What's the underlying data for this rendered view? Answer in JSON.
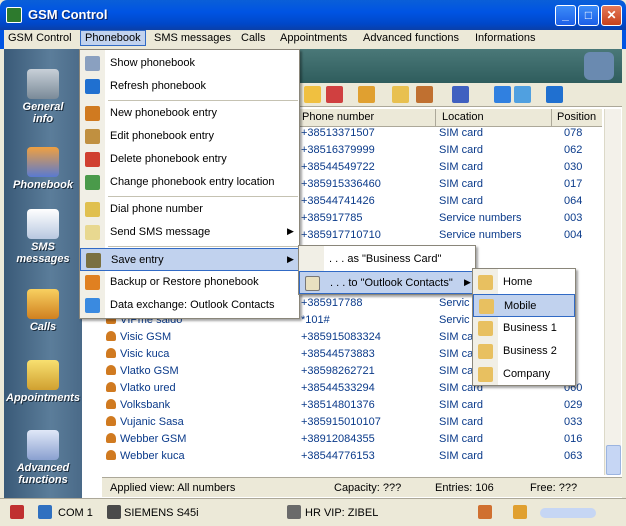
{
  "window": {
    "title": "GSM Control"
  },
  "menubar": [
    "GSM Control",
    "Phonebook",
    "SMS messages",
    "Calls",
    "Appointments",
    "Advanced functions",
    "Informations"
  ],
  "sidebar": {
    "items": [
      {
        "label_line1": "General",
        "label_line2": "info",
        "icon": "phone-icon"
      },
      {
        "label_line1": "Phonebook",
        "label_line2": "",
        "icon": "people-icon"
      },
      {
        "label_line1": "SMS",
        "label_line2": "messages",
        "icon": "envelope-icon"
      },
      {
        "label_line1": "Calls",
        "label_line2": "",
        "icon": "calls-icon"
      },
      {
        "label_line1": "Appointments",
        "label_line2": "",
        "icon": "calendar-icon"
      },
      {
        "label_line1": "Advanced",
        "label_line2": "functions",
        "icon": "tools-icon"
      }
    ]
  },
  "grid": {
    "columns": [
      "Phone number",
      "Location",
      "Position"
    ],
    "rows": [
      {
        "name": "",
        "phone": "+38513371507",
        "location": "SIM card",
        "position": "078"
      },
      {
        "name": "",
        "phone": "+38516379999",
        "location": "SIM card",
        "position": "062"
      },
      {
        "name": "",
        "phone": "+38544549722",
        "location": "SIM card",
        "position": "030"
      },
      {
        "name": "",
        "phone": "+385915336460",
        "location": "SIM card",
        "position": "017"
      },
      {
        "name": "",
        "phone": "+38544741426",
        "location": "SIM card",
        "position": "064"
      },
      {
        "name": "",
        "phone": "+385917785",
        "location": "Service numbers",
        "position": "003"
      },
      {
        "name": "",
        "phone": "+385917710710",
        "location": "Service numbers",
        "position": "004"
      },
      {
        "name": "",
        "phone": "",
        "location": "",
        "position": ""
      },
      {
        "name": "",
        "phone": "",
        "location": "",
        "position": ""
      },
      {
        "name": "",
        "phone": "",
        "location": "",
        "position": ""
      },
      {
        "name": "",
        "phone": "+385917788",
        "location": "Servic",
        "position": ""
      },
      {
        "name": "VIPme saldo",
        "phone": "*101#",
        "location": "Servic",
        "position": ""
      },
      {
        "name": "Visic GSM",
        "phone": "+385915083324",
        "location": "SIM ca",
        "position": ""
      },
      {
        "name": "Visic kuca",
        "phone": "+38544573883",
        "location": "SIM ca",
        "position": ""
      },
      {
        "name": "Vlatko GSM",
        "phone": "+38598262721",
        "location": "SIM ca",
        "position": ""
      },
      {
        "name": "Vlatko ured",
        "phone": "+38544533294",
        "location": "SIM card",
        "position": "060"
      },
      {
        "name": "Volksbank",
        "phone": "+38514801376",
        "location": "SIM card",
        "position": "029"
      },
      {
        "name": "Vujanic Sasa",
        "phone": "+385915010107",
        "location": "SIM card",
        "position": "033"
      },
      {
        "name": "Webber GSM",
        "phone": "+38912084355",
        "location": "SIM card",
        "position": "016"
      },
      {
        "name": "Webber kuca",
        "phone": "+38544776153",
        "location": "SIM card",
        "position": "063"
      }
    ]
  },
  "infobar": {
    "applied_view": "Applied view:  All numbers",
    "capacity": "Capacity:  ???",
    "entries": "Entries:  106",
    "free": "Free:  ???"
  },
  "statusbar": {
    "port": "COM 1",
    "device": "SIEMENS S45i",
    "network": "HR VIP:  ZIBEL"
  },
  "phonebook_menu": {
    "items": [
      {
        "label": "Show phonebook",
        "icon": "magnifier-icon"
      },
      {
        "label": "Refresh phonebook",
        "icon": "refresh-icon"
      },
      {
        "label": "New phonebook entry",
        "icon": "new-entry-icon"
      },
      {
        "label": "Edit phonebook entry",
        "icon": "edit-entry-icon"
      },
      {
        "label": "Delete phonebook entry",
        "icon": "delete-entry-icon"
      },
      {
        "label": "Change phonebook entry location",
        "icon": "move-entry-icon"
      },
      {
        "label": "Dial phone number",
        "icon": "dial-icon"
      },
      {
        "label": "Send SMS message",
        "icon": "sms-icon"
      },
      {
        "label": "Save entry",
        "icon": "save-icon"
      },
      {
        "label": "Backup or Restore phonebook",
        "icon": "backup-icon"
      },
      {
        "label": "Data exchange:  Outlook Contacts",
        "icon": "outlook-icon"
      }
    ]
  },
  "save_submenu": {
    "items": [
      {
        "label": ". . . as \"Business Card\""
      },
      {
        "label": ". . . to \"Outlook Contacts\""
      }
    ]
  },
  "outlook_submenu": {
    "items": [
      {
        "label": "Home"
      },
      {
        "label": "Mobile"
      },
      {
        "label": "Business 1"
      },
      {
        "label": "Business 2"
      },
      {
        "label": "Company"
      }
    ]
  },
  "colors": {
    "titlebar": "#0054e3",
    "highlight": "#c1d2ee",
    "highlight_border": "#316ac5",
    "sidebar": "#4a6a88",
    "grid_text": "#0a3a8a"
  }
}
